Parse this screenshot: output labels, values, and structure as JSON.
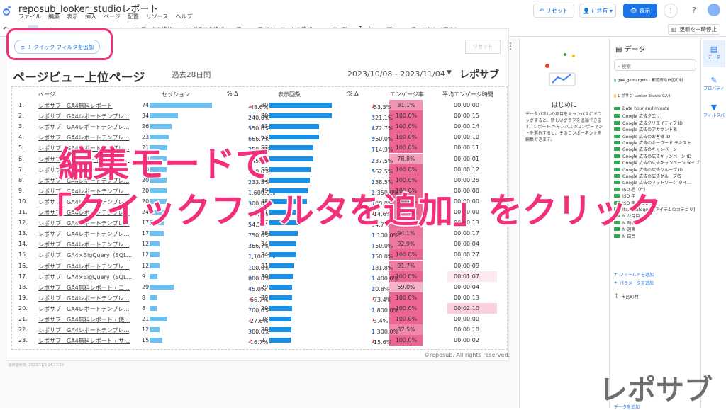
{
  "app": {
    "title": "reposub_looker_studioレポート",
    "menus": [
      "ファイル",
      "編集",
      "表示",
      "挿入",
      "ページ",
      "配置",
      "リソース",
      "ヘルプ"
    ],
    "reset_label": "リセット",
    "share_label": "共有",
    "view_label": "表示"
  },
  "toolbar": {
    "add_data": "データを追加",
    "add_chart": "グラフを追加",
    "add_control": "コントロールを追加",
    "theme": "テーマとレイアウト",
    "pause_update": "更新を一時停止"
  },
  "canvas": {
    "quick_filter": "クイック フィルタを追加",
    "reset": "リセット",
    "copyright": "©reposub. All rights reserved.",
    "updated": "最終更新日: 2023/11/5 14:17:58"
  },
  "report": {
    "title": "ページビュー上位ページ",
    "period": "過去28日間",
    "date_range": "2023/10/08 - 2023/11/04",
    "brand": "レポサブ"
  },
  "table": {
    "headers": [
      "ページ",
      "セッション",
      "% Δ",
      "表示回数",
      "% Δ",
      "エンゲージ率",
      "平均エンゲージ時間"
    ],
    "rows": [
      {
        "n": "1.",
        "page": "レポサブ　GA4無料レポート",
        "s": "74",
        "sd": "-48.6%",
        "sdir": "down",
        "v": "80",
        "vd": "-53.5%",
        "vdir": "down",
        "e": "81.1%",
        "t": "00:00:00",
        "sb": 1.0,
        "vb": 1.0,
        "ea": 0.55,
        "ta": 0
      },
      {
        "n": "2.",
        "page": "レポサブ　GA4レポートテンプレ…",
        "s": "34",
        "sd": "240.0%",
        "sdir": "up",
        "v": "80",
        "vd": "321.1%",
        "vdir": "up",
        "e": "100.0%",
        "t": "00:00:15",
        "sb": 0.46,
        "vb": 1.0,
        "ea": 0.8,
        "ta": 0
      },
      {
        "n": "3.",
        "page": "レポサブ　GA4レポートテンプレ…",
        "s": "26",
        "sd": "550.0%",
        "sdir": "up",
        "v": "63",
        "vd": "472.7%",
        "vdir": "up",
        "e": "100.0%",
        "t": "00:00:14",
        "sb": 0.35,
        "vb": 0.79,
        "ea": 0.8,
        "ta": 0
      },
      {
        "n": "4.",
        "page": "レポサブ　GA4レポートテンプレ…",
        "s": "23",
        "sd": "666.7%",
        "sdir": "up",
        "v": "63",
        "vd": "950.0%",
        "vdir": "up",
        "e": "100.0%",
        "t": "00:00:10",
        "sb": 0.31,
        "vb": 0.79,
        "ea": 0.8,
        "ta": 0
      },
      {
        "n": "5.",
        "page": "レポサブ　GA4レポートテンプレ…",
        "s": "21",
        "sd": "250.0%",
        "sdir": "up",
        "v": "57",
        "vd": "714.3%",
        "vdir": "up",
        "e": "100.0%",
        "t": "00:00:11",
        "sb": 0.28,
        "vb": 0.71,
        "ea": 0.8,
        "ta": 0
      },
      {
        "n": "6.",
        "page": "レポサブ　GA4レポートテンプレ…",
        "s": "20",
        "sd": "245.7%",
        "sdir": "up",
        "v": "57",
        "vd": "237.5%",
        "vdir": "up",
        "e": "78.8%",
        "t": "00:00:01",
        "sb": 0.27,
        "vb": 0.71,
        "ea": 0.5,
        "ta": 0
      },
      {
        "n": "7.",
        "page": "レポサブ　GA4レポートテンプレ…",
        "s": "20",
        "sd": "300.0%",
        "sdir": "up",
        "v": "53",
        "vd": "562.5%",
        "vdir": "up",
        "e": "100.0%",
        "t": "00:00:12",
        "sb": 0.27,
        "vb": 0.66,
        "ea": 0.8,
        "ta": 0
      },
      {
        "n": "8.",
        "page": "レポサブ　GA4レポートテンプレ…",
        "s": "20",
        "sd": "233.3%",
        "sdir": "up",
        "v": "52",
        "vd": "238.5%",
        "vdir": "up",
        "e": "100.0%",
        "t": "00:00:25",
        "sb": 0.27,
        "vb": 0.65,
        "ea": 0.8,
        "ta": 0
      },
      {
        "n": "9.",
        "page": "レポサブ　GA4レポートテンプレ…",
        "s": "20",
        "sd": "1,600.0%",
        "sdir": "up",
        "v": "49",
        "vd": "2,350.0%",
        "vdir": "up",
        "e": "100.0%",
        "t": "00:00:00",
        "sb": 0.27,
        "vb": 0.61,
        "ea": 0.8,
        "ta": 0
      },
      {
        "n": "10.",
        "page": "レポサブ　GA4レポートテンプレ…",
        "s": "20",
        "sd": "300.0%",
        "sdir": "up",
        "v": "48",
        "vd": "700.0%",
        "vdir": "up",
        "e": "100.0%",
        "t": "00:00:00",
        "sb": 0.27,
        "vb": 0.6,
        "ea": 0.8,
        "ta": 0
      },
      {
        "n": "11.",
        "page": "レポサブ　GA4レポートテンプレ…",
        "s": "24",
        "sd": "-20.0%",
        "sdir": "down",
        "v": "41",
        "vd": "-14.6%",
        "vdir": "down",
        "e": "100.0%",
        "t": "00:00:00",
        "sb": 0.32,
        "vb": 0.51,
        "ea": 0.8,
        "ta": 0
      },
      {
        "n": "12.",
        "page": "レポサブ　GA4レポートテンプレ…",
        "s": "17",
        "sd": "54.5%",
        "sdir": "up",
        "v": "37",
        "vd": "94.7%",
        "vdir": "up",
        "e": "100.0%",
        "t": "00:00:13",
        "sb": 0.23,
        "vb": 0.46,
        "ea": 0.8,
        "ta": 0
      },
      {
        "n": "13.",
        "page": "レポサブ　GA4レポートテンプレ…",
        "s": "17",
        "sd": "750.0%",
        "sdir": "up",
        "v": "36",
        "vd": "1,100.0%",
        "vdir": "up",
        "e": "94.1%",
        "t": "00:00:17",
        "sb": 0.23,
        "vb": 0.45,
        "ea": 0.72,
        "ta": 0
      },
      {
        "n": "14.",
        "page": "レポサブ　GA4レポートテンプレ…",
        "s": "12",
        "sd": "366.7%",
        "sdir": "up",
        "v": "34",
        "vd": "750.0%",
        "vdir": "up",
        "e": "92.9%",
        "t": "00:00:04",
        "sb": 0.16,
        "vb": 0.43,
        "ea": 0.7,
        "ta": 0
      },
      {
        "n": "15.",
        "page": "レポサブ　GA4×BigQuery（SQL…",
        "s": "12",
        "sd": "1,100.0%",
        "sdir": "up",
        "v": "34",
        "vd": "750.0%",
        "vdir": "up",
        "e": "100.0%",
        "t": "00:00:27",
        "sb": 0.16,
        "vb": 0.43,
        "ea": 0.8,
        "ta": 0
      },
      {
        "n": "16.",
        "page": "レポサブ　GA4レポートテンプレ…",
        "s": "12",
        "sd": "100.0%",
        "sdir": "up",
        "v": "31",
        "vd": "181.8%",
        "vdir": "up",
        "e": "91.7%",
        "t": "00:00:09",
        "sb": 0.16,
        "vb": 0.39,
        "ea": 0.68,
        "ta": 0
      },
      {
        "n": "17.",
        "page": "レポサブ　GA4×BigQuery（SQL…",
        "s": "9",
        "sd": "800.0%",
        "sdir": "up",
        "v": "30",
        "vd": "1,400.0%",
        "vdir": "up",
        "e": "100.0%",
        "t": "00:01:07",
        "sb": 0.12,
        "vb": 0.38,
        "ea": 0.8,
        "ta": 0.12
      },
      {
        "n": "18.",
        "page": "レポサブ　GA4無料レポート › コ…",
        "s": "29",
        "sd": "45.0%",
        "sdir": "up",
        "v": "29",
        "vd": "20.8%",
        "vdir": "up",
        "e": "69.0%",
        "t": "00:00:04",
        "sb": 0.39,
        "vb": 0.36,
        "ea": 0.4,
        "ta": 0
      },
      {
        "n": "19.",
        "page": "レポサブ　GA4レポートテンプレ…",
        "s": "8",
        "sd": "-66.7%",
        "sdir": "down",
        "v": "29",
        "vd": "-73.4%",
        "vdir": "down",
        "e": "100.0%",
        "t": "00:00:13",
        "sb": 0.11,
        "vb": 0.36,
        "ea": 0.8,
        "ta": 0
      },
      {
        "n": "20.",
        "page": "レポサブ　GA4レポートテンプレ…",
        "s": "8",
        "sd": "700.0%",
        "sdir": "up",
        "v": "29",
        "vd": "2,800.0%",
        "vdir": "up",
        "e": "100.0%",
        "t": "00:02:10",
        "sb": 0.11,
        "vb": 0.36,
        "ea": 0.8,
        "ta": 0.25
      },
      {
        "n": "21.",
        "page": "レポサブ　GA4無料レポート › 使…",
        "s": "21",
        "sd": "-27.6%",
        "sdir": "down",
        "v": "28",
        "vd": "-3.4%",
        "vdir": "down",
        "e": "100.0%",
        "t": "00:00:00",
        "sb": 0.28,
        "vb": 0.35,
        "ea": 0.8,
        "ta": 0
      },
      {
        "n": "22.",
        "page": "レポサブ　GA4レポートテンプレ…",
        "s": "12",
        "sd": "300.0%",
        "sdir": "up",
        "v": "28",
        "vd": "1,300.0%",
        "vdir": "up",
        "e": "87.5%",
        "t": "00:00:10",
        "sb": 0.16,
        "vb": 0.35,
        "ea": 0.62,
        "ta": 0
      },
      {
        "n": "23.",
        "page": "レポサブ　GA4無料レポート › サ…",
        "s": "15",
        "sd": "-16.7%",
        "sdir": "down",
        "v": "27",
        "vd": "-15.6%",
        "vdir": "down",
        "e": "100.0%",
        "t": "00:00:02",
        "sb": 0.2,
        "vb": 0.34,
        "ea": 0.8,
        "ta": 0
      }
    ]
  },
  "welcome": {
    "title": "はじめに",
    "body": "データパネルの項目をキャンバスにドラッグすると、新しいグラフを追加できます。レポート キャンバスのコンポーネントを選択すると、そのコンポーネントを編集できます。"
  },
  "data_panel": {
    "title": "データ",
    "search": "検索",
    "source1": "ga4_geotargets - 都道府県市区町村",
    "source2": "レポサブ Looker Studio GA4",
    "fields": [
      "Date hour and minute",
      "Google 広告クエリ",
      "Google 広告クリエイティブ ID",
      "Google 広告のアカウント名",
      "Google 広告のお客様 ID",
      "Google 広告のキーワード テキスト",
      "Google 広告のキャンペーン",
      "Google 広告の広告キャンペーン ID",
      "Google 広告の広告キャンペーン タイプ",
      "Google 広告の広告グループ ID",
      "Google 広告の広告グループ名",
      "Google 広告のネットワーク タイ…",
      "ISO 週（年）",
      "ISO 年",
      "ISO 年の ISO 週",
      "Item category [アイテムのカテゴリ]",
      "N か月目",
      "N 時間目",
      "N 週目",
      "N 日目"
    ],
    "add_field": "フィールドを追加",
    "add_param": "パラメータを追加",
    "dimension": "市区町村",
    "add_data": "データを追加"
  },
  "side_tabs": [
    "データ",
    "プロパティ",
    "フィルタバ"
  ],
  "overlay": {
    "line1": "編集モードで",
    "line2": "「クイックフィルタを追加」をクリック"
  },
  "watermark": "レポサブ",
  "colors": {
    "accent": "#f0307b",
    "blue": "#1a73e8"
  }
}
